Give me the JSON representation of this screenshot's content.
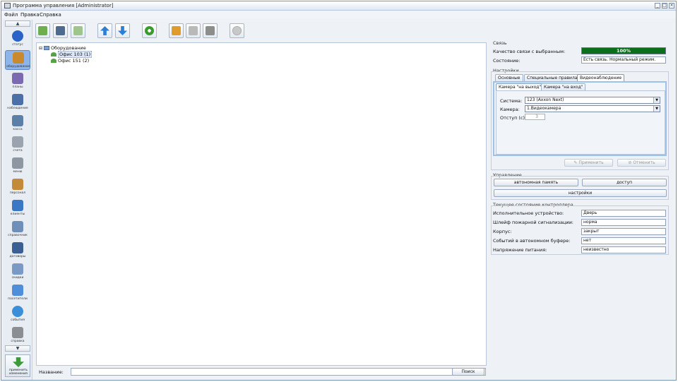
{
  "window": {
    "title": "Программа управления [Administrator]",
    "buttons": [
      "_",
      "□",
      "×"
    ]
  },
  "menu": [
    "Файл",
    "Правка",
    "Справка"
  ],
  "sidebar": {
    "items": [
      {
        "label": "статус",
        "icon": "info-icon",
        "color": "#2a62c8"
      },
      {
        "label": "оборудование",
        "icon": "equipment-icon",
        "color": "#c98a2e",
        "active": true
      },
      {
        "label": "планы",
        "icon": "plans-icon",
        "color": "#7b6ab0"
      },
      {
        "label": "наблюдение",
        "icon": "observer-icon",
        "color": "#4c6fa8"
      },
      {
        "label": "касса",
        "icon": "cashier-icon",
        "color": "#5c7fa8"
      },
      {
        "label": "счета",
        "icon": "bills-icon",
        "color": "#9aa3ae"
      },
      {
        "label": "меню",
        "icon": "menu-icon",
        "color": "#8d96a1"
      },
      {
        "label": "персонал",
        "icon": "staff-icon",
        "color": "#c38a3a"
      },
      {
        "label": "клиенты",
        "icon": "clients-icon",
        "color": "#3a78c6"
      },
      {
        "label": "справочник",
        "icon": "directory-icon",
        "color": "#6f8fb8"
      },
      {
        "label": "договоры",
        "icon": "contracts-icon",
        "color": "#3b5f93"
      },
      {
        "label": "скидки",
        "icon": "discounts-icon",
        "color": "#7a99c4"
      },
      {
        "label": "посетители",
        "icon": "visitors-icon",
        "color": "#4f8ed8"
      },
      {
        "label": "события",
        "icon": "events-icon",
        "color": "#3a8fd8"
      },
      {
        "label": "справка",
        "icon": "help-icon",
        "color": "#8b8f94"
      }
    ],
    "apply_label": "применить изменения"
  },
  "toolbar": {
    "buttons": [
      "add-icon",
      "save-icon",
      "copy-icon",
      "move-up-icon",
      "move-down-icon",
      "refresh-icon",
      "lock-icon",
      "lock-gray-icon",
      "unlock-icon",
      "remove-icon"
    ]
  },
  "tree": {
    "root": "Оборудование",
    "children": [
      "Офис 103 (1)",
      "Офис 151 (2)"
    ]
  },
  "search": {
    "label": "Название:",
    "value": "",
    "button": "Поиск"
  },
  "connection": {
    "section": "Связь",
    "quality_label": "Качество связи с выбранным:",
    "quality_value": "100%",
    "quality_fraction": 1.0,
    "quality_color": "#0b6e1b",
    "state_label": "Состояние:",
    "state_value": "Есть связь. Нормальный режим."
  },
  "settings": {
    "section": "Настройки",
    "tabs": [
      "Основные",
      "Специальные правила",
      "Видеонаблюдение"
    ],
    "subtabs": [
      "Камера \"на выход\"",
      "Камера \"на вход\""
    ],
    "system_label": "Система:",
    "system_value": "123 (Axxon Next)",
    "camera_label": "Камера:",
    "camera_value": "1.Видеокамера",
    "offset_label": "Отступ (с):",
    "offset_value": "3",
    "apply": "Применить",
    "cancel": "Отменить"
  },
  "control": {
    "section": "Управление",
    "autonomous": "автономная память",
    "access": "доступ",
    "settings": "настройки"
  },
  "status": {
    "section": "Текущее состояние контроллера",
    "rows": [
      {
        "label": "Исполнительное устройство:",
        "value": "Дверь"
      },
      {
        "label": "Шлейф пожарной сигнализации:",
        "value": "норма"
      },
      {
        "label": "Корпус:",
        "value": "закрыт"
      },
      {
        "label": "Событий в автономном буфере:",
        "value": "нет"
      },
      {
        "label": "Напряжение питания:",
        "value": "неизвестно"
      }
    ]
  }
}
